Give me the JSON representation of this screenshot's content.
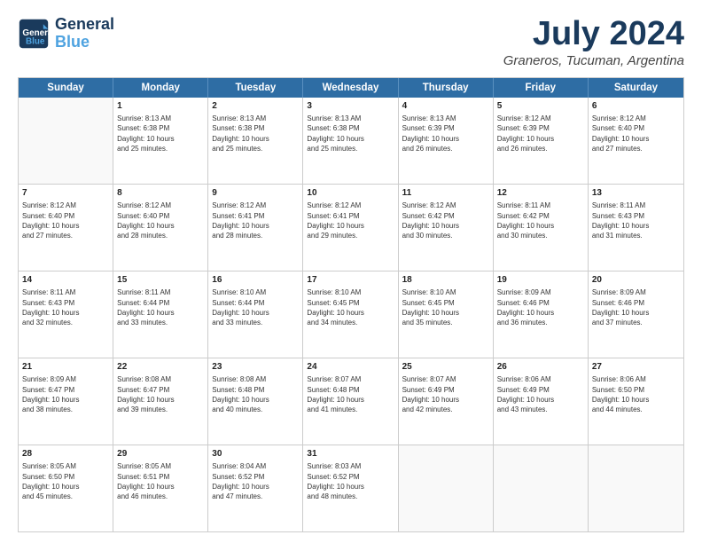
{
  "header": {
    "logo_line1": "General",
    "logo_line2": "Blue",
    "month": "July 2024",
    "location": "Graneros, Tucuman, Argentina"
  },
  "weekdays": [
    "Sunday",
    "Monday",
    "Tuesday",
    "Wednesday",
    "Thursday",
    "Friday",
    "Saturday"
  ],
  "weeks": [
    [
      {
        "day": "",
        "info": ""
      },
      {
        "day": "1",
        "info": "Sunrise: 8:13 AM\nSunset: 6:38 PM\nDaylight: 10 hours\nand 25 minutes."
      },
      {
        "day": "2",
        "info": "Sunrise: 8:13 AM\nSunset: 6:38 PM\nDaylight: 10 hours\nand 25 minutes."
      },
      {
        "day": "3",
        "info": "Sunrise: 8:13 AM\nSunset: 6:38 PM\nDaylight: 10 hours\nand 25 minutes."
      },
      {
        "day": "4",
        "info": "Sunrise: 8:13 AM\nSunset: 6:39 PM\nDaylight: 10 hours\nand 26 minutes."
      },
      {
        "day": "5",
        "info": "Sunrise: 8:12 AM\nSunset: 6:39 PM\nDaylight: 10 hours\nand 26 minutes."
      },
      {
        "day": "6",
        "info": "Sunrise: 8:12 AM\nSunset: 6:40 PM\nDaylight: 10 hours\nand 27 minutes."
      }
    ],
    [
      {
        "day": "7",
        "info": "Sunrise: 8:12 AM\nSunset: 6:40 PM\nDaylight: 10 hours\nand 27 minutes."
      },
      {
        "day": "8",
        "info": "Sunrise: 8:12 AM\nSunset: 6:40 PM\nDaylight: 10 hours\nand 28 minutes."
      },
      {
        "day": "9",
        "info": "Sunrise: 8:12 AM\nSunset: 6:41 PM\nDaylight: 10 hours\nand 28 minutes."
      },
      {
        "day": "10",
        "info": "Sunrise: 8:12 AM\nSunset: 6:41 PM\nDaylight: 10 hours\nand 29 minutes."
      },
      {
        "day": "11",
        "info": "Sunrise: 8:12 AM\nSunset: 6:42 PM\nDaylight: 10 hours\nand 30 minutes."
      },
      {
        "day": "12",
        "info": "Sunrise: 8:11 AM\nSunset: 6:42 PM\nDaylight: 10 hours\nand 30 minutes."
      },
      {
        "day": "13",
        "info": "Sunrise: 8:11 AM\nSunset: 6:43 PM\nDaylight: 10 hours\nand 31 minutes."
      }
    ],
    [
      {
        "day": "14",
        "info": "Sunrise: 8:11 AM\nSunset: 6:43 PM\nDaylight: 10 hours\nand 32 minutes."
      },
      {
        "day": "15",
        "info": "Sunrise: 8:11 AM\nSunset: 6:44 PM\nDaylight: 10 hours\nand 33 minutes."
      },
      {
        "day": "16",
        "info": "Sunrise: 8:10 AM\nSunset: 6:44 PM\nDaylight: 10 hours\nand 33 minutes."
      },
      {
        "day": "17",
        "info": "Sunrise: 8:10 AM\nSunset: 6:45 PM\nDaylight: 10 hours\nand 34 minutes."
      },
      {
        "day": "18",
        "info": "Sunrise: 8:10 AM\nSunset: 6:45 PM\nDaylight: 10 hours\nand 35 minutes."
      },
      {
        "day": "19",
        "info": "Sunrise: 8:09 AM\nSunset: 6:46 PM\nDaylight: 10 hours\nand 36 minutes."
      },
      {
        "day": "20",
        "info": "Sunrise: 8:09 AM\nSunset: 6:46 PM\nDaylight: 10 hours\nand 37 minutes."
      }
    ],
    [
      {
        "day": "21",
        "info": "Sunrise: 8:09 AM\nSunset: 6:47 PM\nDaylight: 10 hours\nand 38 minutes."
      },
      {
        "day": "22",
        "info": "Sunrise: 8:08 AM\nSunset: 6:47 PM\nDaylight: 10 hours\nand 39 minutes."
      },
      {
        "day": "23",
        "info": "Sunrise: 8:08 AM\nSunset: 6:48 PM\nDaylight: 10 hours\nand 40 minutes."
      },
      {
        "day": "24",
        "info": "Sunrise: 8:07 AM\nSunset: 6:48 PM\nDaylight: 10 hours\nand 41 minutes."
      },
      {
        "day": "25",
        "info": "Sunrise: 8:07 AM\nSunset: 6:49 PM\nDaylight: 10 hours\nand 42 minutes."
      },
      {
        "day": "26",
        "info": "Sunrise: 8:06 AM\nSunset: 6:49 PM\nDaylight: 10 hours\nand 43 minutes."
      },
      {
        "day": "27",
        "info": "Sunrise: 8:06 AM\nSunset: 6:50 PM\nDaylight: 10 hours\nand 44 minutes."
      }
    ],
    [
      {
        "day": "28",
        "info": "Sunrise: 8:05 AM\nSunset: 6:50 PM\nDaylight: 10 hours\nand 45 minutes."
      },
      {
        "day": "29",
        "info": "Sunrise: 8:05 AM\nSunset: 6:51 PM\nDaylight: 10 hours\nand 46 minutes."
      },
      {
        "day": "30",
        "info": "Sunrise: 8:04 AM\nSunset: 6:52 PM\nDaylight: 10 hours\nand 47 minutes."
      },
      {
        "day": "31",
        "info": "Sunrise: 8:03 AM\nSunset: 6:52 PM\nDaylight: 10 hours\nand 48 minutes."
      },
      {
        "day": "",
        "info": ""
      },
      {
        "day": "",
        "info": ""
      },
      {
        "day": "",
        "info": ""
      }
    ]
  ]
}
